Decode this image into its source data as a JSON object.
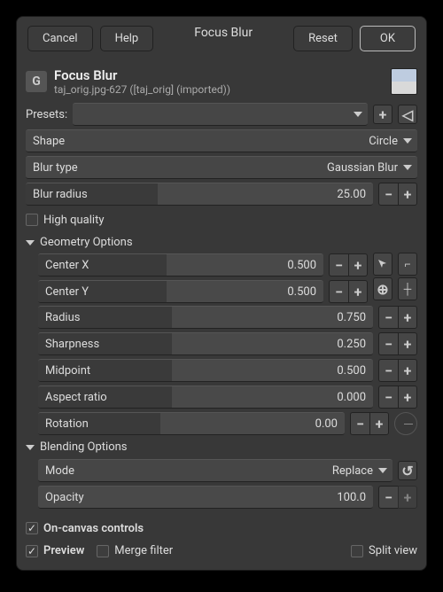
{
  "titlebar": {
    "cancel": "Cancel",
    "help": "Help",
    "title": "Focus Blur",
    "reset": "Reset",
    "ok": "OK"
  },
  "header": {
    "title": "Focus Blur",
    "subtitle": "taj_orig.jpg-627 ([taj_orig] (imported))"
  },
  "presets": {
    "label": "Presets:"
  },
  "shape": {
    "label": "Shape",
    "value": "Circle"
  },
  "blur_type": {
    "label": "Blur type",
    "value": "Gaussian Blur"
  },
  "blur_radius": {
    "label": "Blur radius",
    "value": "25.00"
  },
  "high_quality": {
    "label": "High quality"
  },
  "geometry": {
    "title": "Geometry Options",
    "center_x": {
      "label": "Center X",
      "value": "0.500"
    },
    "center_y": {
      "label": "Center Y",
      "value": "0.500"
    },
    "radius": {
      "label": "Radius",
      "value": "0.750"
    },
    "sharpness": {
      "label": "Sharpness",
      "value": "0.250"
    },
    "midpoint": {
      "label": "Midpoint",
      "value": "0.500"
    },
    "aspect": {
      "label": "Aspect ratio",
      "value": "0.000"
    },
    "rotation": {
      "label": "Rotation",
      "value": "0.00"
    }
  },
  "blending": {
    "title": "Blending Options",
    "mode": {
      "label": "Mode",
      "value": "Replace"
    },
    "opacity": {
      "label": "Opacity",
      "value": "100.0"
    }
  },
  "footer": {
    "on_canvas": "On-canvas controls",
    "preview": "Preview",
    "merge": "Merge filter",
    "split": "Split view"
  }
}
